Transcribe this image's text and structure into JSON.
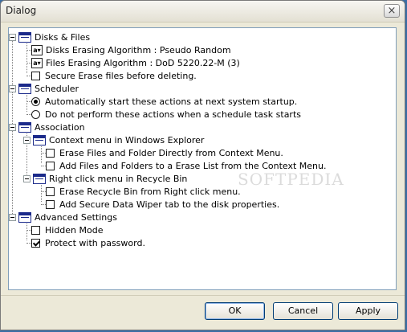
{
  "window": {
    "title": "Dialog",
    "close_glyph": "×"
  },
  "tree": {
    "disks": {
      "label": "Disks & Files",
      "items": [
        "Disks Erasing Algorithm : Pseudo Random",
        "Files Erasing Algorithm : DoD 5220.22-M (3)",
        "Secure Erase files before deleting."
      ],
      "combo_icon": "a▾"
    },
    "scheduler": {
      "label": "Scheduler",
      "items": [
        "Automatically start these actions at next system startup.",
        "Do not perform these actions when a schedule task starts"
      ],
      "selected_index": 0
    },
    "association": {
      "label": "Association",
      "context_menu": {
        "label": "Context menu in Windows Explorer",
        "items": [
          "Erase Files and Folder Directly from Context Menu.",
          "Add Files and Folders to a Erase List from the Context Menu."
        ]
      },
      "recycle_bin": {
        "label": "Right click menu in Recycle Bin",
        "items": [
          "Erase Recycle Bin from Right click menu.",
          "Add Secure Data Wiper tab to the disk properties."
        ]
      }
    },
    "advanced": {
      "label": "Advanced Settings",
      "items": [
        "Hidden Mode",
        "Protect with password."
      ],
      "checked": [
        false,
        true
      ]
    }
  },
  "watermark": "SOFTPEDIA",
  "buttons": {
    "ok": "OK",
    "cancel": "Cancel",
    "apply": "Apply"
  }
}
